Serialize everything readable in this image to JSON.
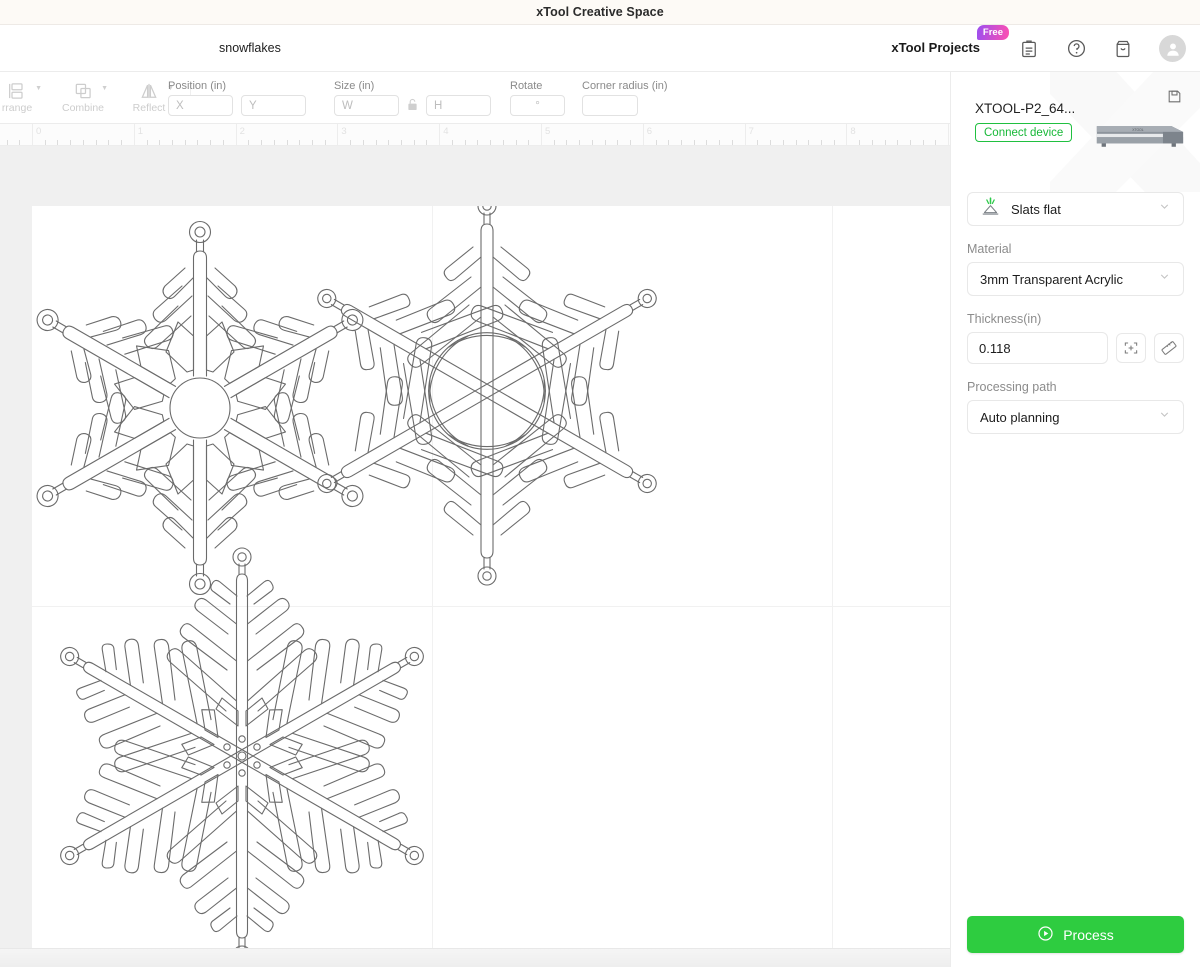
{
  "window": {
    "title": "xTool Creative Space"
  },
  "header": {
    "document_name": "snowflakes",
    "projects_button": "xTool Projects",
    "free_badge": "Free",
    "icons": [
      {
        "name": "notes-icon",
        "label": "Notes"
      },
      {
        "name": "help-icon",
        "label": "Help"
      },
      {
        "name": "store-icon",
        "label": "Store"
      },
      {
        "name": "avatar",
        "label": "Account"
      }
    ]
  },
  "toolbar": {
    "tools": [
      {
        "name": "arrange",
        "label": "rrange",
        "has_caret": true
      },
      {
        "name": "combine",
        "label": "Combine",
        "has_caret": true
      },
      {
        "name": "reflect",
        "label": "Reflect",
        "has_caret": true
      }
    ],
    "position": {
      "label": "Position (in)",
      "x_placeholder": "X",
      "x_value": "",
      "y_placeholder": "Y",
      "y_value": ""
    },
    "size": {
      "label": "Size (in)",
      "w_placeholder": "W",
      "w_value": "",
      "h_placeholder": "H",
      "h_value": "",
      "lock_state": "unlocked"
    },
    "rotate": {
      "label": "Rotate",
      "placeholder": "°",
      "value": ""
    },
    "corner_radius": {
      "label": "Corner radius (in)",
      "placeholder": "",
      "value": ""
    }
  },
  "ruler": {
    "unit": "in",
    "ticks": [
      "0",
      "1",
      "2",
      "3",
      "4",
      "5",
      "6",
      "7",
      "8"
    ]
  },
  "canvas": {
    "objects": [
      {
        "name": "snowflake-1",
        "kind": "snowflake-hex-ornament"
      },
      {
        "name": "snowflake-2",
        "kind": "snowflake-needle"
      },
      {
        "name": "snowflake-3",
        "kind": "snowflake-dendrite"
      }
    ]
  },
  "panel": {
    "device_name": "XTOOL-P2_64...",
    "connect_button": "Connect device",
    "save_icon": "save-icon",
    "accessory": {
      "label": "Slats flat",
      "icon": "laser-slats-icon"
    },
    "material": {
      "label": "Material",
      "value": "3mm Transparent Acrylic"
    },
    "thickness": {
      "label": "Thickness(in)",
      "value": "0.118",
      "measure_icon": "autofocus-icon",
      "ruler_icon": "measure-ruler-icon"
    },
    "processing_path": {
      "label": "Processing path",
      "value": "Auto planning"
    },
    "process_button": "Process"
  },
  "colors": {
    "accent_green": "#2ecc40",
    "connect_green": "#18b838",
    "titlebar_bg": "#fdfaf6",
    "canvas_bg": "#f0f0f0",
    "stroke": "#6b6b6b"
  }
}
